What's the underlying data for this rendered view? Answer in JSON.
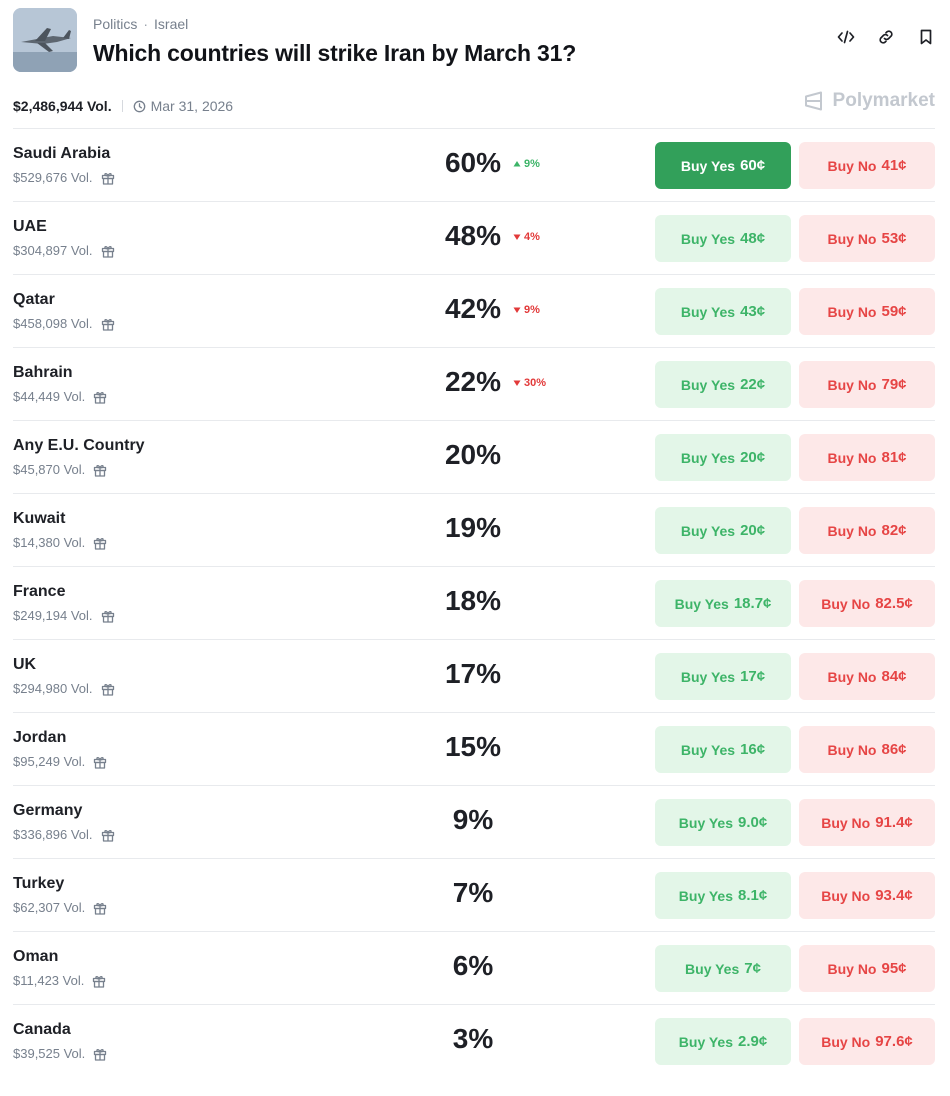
{
  "header": {
    "breadcrumbs": [
      "Politics",
      "Israel"
    ],
    "title": "Which countries will strike Iran by March 31?",
    "total_volume": "$2,486,944 Vol.",
    "end_date": "Mar 31, 2026",
    "brand": "Polymarket"
  },
  "buttons": {
    "yes_prefix": "Buy Yes",
    "no_prefix": "Buy No"
  },
  "colors": {
    "yes_green": "#3db468",
    "yes_active": "#32a05a",
    "no_red": "#e64545",
    "yes_bg": "#e3f6e8",
    "no_bg": "#fde8e8"
  },
  "markets": [
    {
      "name": "Saudi Arabia",
      "volume": "$529,676 Vol.",
      "chance": "60%",
      "change": "9%",
      "direction": "up",
      "yes_price": "60¢",
      "no_price": "41¢",
      "yes_active": true
    },
    {
      "name": "UAE",
      "volume": "$304,897 Vol.",
      "chance": "48%",
      "change": "4%",
      "direction": "down",
      "yes_price": "48¢",
      "no_price": "53¢"
    },
    {
      "name": "Qatar",
      "volume": "$458,098 Vol.",
      "chance": "42%",
      "change": "9%",
      "direction": "down",
      "yes_price": "43¢",
      "no_price": "59¢"
    },
    {
      "name": "Bahrain",
      "volume": "$44,449 Vol.",
      "chance": "22%",
      "change": "30%",
      "direction": "down",
      "yes_price": "22¢",
      "no_price": "79¢"
    },
    {
      "name": "Any E.U. Country",
      "volume": "$45,870 Vol.",
      "chance": "20%",
      "change": "",
      "direction": "",
      "yes_price": "20¢",
      "no_price": "81¢"
    },
    {
      "name": "Kuwait",
      "volume": "$14,380 Vol.",
      "chance": "19%",
      "change": "",
      "direction": "",
      "yes_price": "20¢",
      "no_price": "82¢"
    },
    {
      "name": "France",
      "volume": "$249,194 Vol.",
      "chance": "18%",
      "change": "",
      "direction": "",
      "yes_price": "18.7¢",
      "no_price": "82.5¢"
    },
    {
      "name": "UK",
      "volume": "$294,980 Vol.",
      "chance": "17%",
      "change": "",
      "direction": "",
      "yes_price": "17¢",
      "no_price": "84¢"
    },
    {
      "name": "Jordan",
      "volume": "$95,249 Vol.",
      "chance": "15%",
      "change": "",
      "direction": "",
      "yes_price": "16¢",
      "no_price": "86¢"
    },
    {
      "name": "Germany",
      "volume": "$336,896 Vol.",
      "chance": "9%",
      "change": "",
      "direction": "",
      "yes_price": "9.0¢",
      "no_price": "91.4¢"
    },
    {
      "name": "Turkey",
      "volume": "$62,307 Vol.",
      "chance": "7%",
      "change": "",
      "direction": "",
      "yes_price": "8.1¢",
      "no_price": "93.4¢"
    },
    {
      "name": "Oman",
      "volume": "$11,423 Vol.",
      "chance": "6%",
      "change": "",
      "direction": "",
      "yes_price": "7¢",
      "no_price": "95¢"
    },
    {
      "name": "Canada",
      "volume": "$39,525 Vol.",
      "chance": "3%",
      "change": "",
      "direction": "",
      "yes_price": "2.9¢",
      "no_price": "97.6¢"
    }
  ]
}
